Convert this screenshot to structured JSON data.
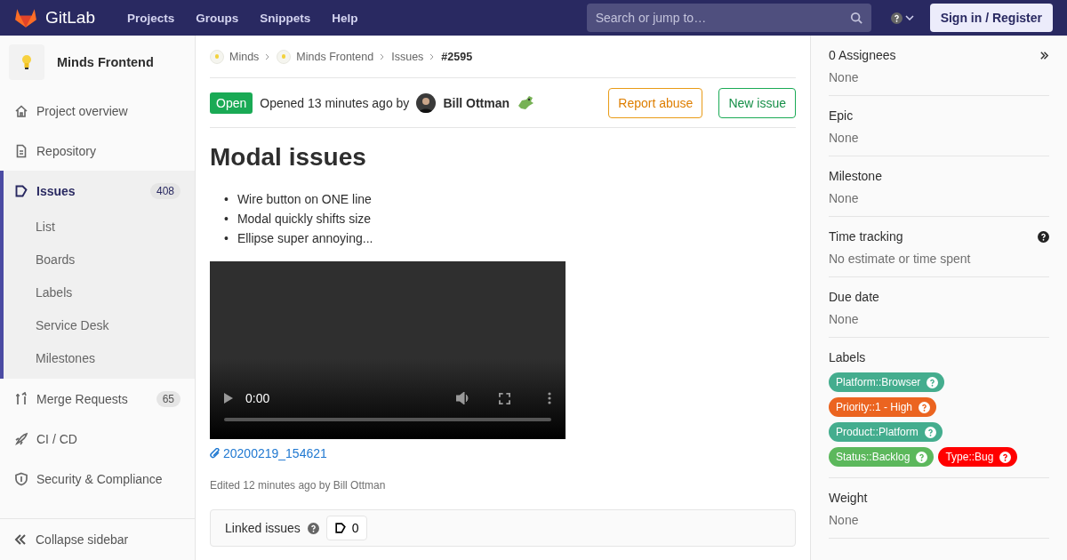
{
  "topbar": {
    "brand": "GitLab",
    "nav": [
      "Projects",
      "Groups",
      "Snippets",
      "Help"
    ],
    "search": {
      "placeholder": "Search or jump to…"
    },
    "sign_in": "Sign in / Register"
  },
  "sidebar": {
    "project": "Minds Frontend",
    "items": [
      {
        "label": "Project overview",
        "selected": false
      },
      {
        "label": "Repository",
        "selected": false
      },
      {
        "label": "Issues",
        "selected": true,
        "count": "408",
        "children": [
          {
            "label": "List"
          },
          {
            "label": "Boards"
          },
          {
            "label": "Labels"
          },
          {
            "label": "Service Desk"
          },
          {
            "label": "Milestones"
          }
        ]
      },
      {
        "label": "Merge Requests",
        "selected": false,
        "count": "65"
      },
      {
        "label": "CI / CD",
        "selected": false
      },
      {
        "label": "Security & Compliance",
        "selected": false
      }
    ],
    "collapse": "Collapse sidebar"
  },
  "breadcrumbs": [
    {
      "label": "Minds",
      "avatar": true
    },
    {
      "label": "Minds Frontend",
      "avatar": true
    },
    {
      "label": "Issues"
    },
    {
      "label": "#2595"
    }
  ],
  "issue": {
    "status": "Open",
    "opened": "Opened 13 minutes ago by",
    "author": "Bill Ottman",
    "actions": [
      {
        "label": "Report abuse",
        "kind": "warning"
      },
      {
        "label": "New issue",
        "kind": "success"
      }
    ],
    "title": "Modal issues",
    "bullets": [
      {
        "marker": "•",
        "text": "Wire button on ONE line"
      },
      {
        "marker": "•",
        "text": "Modal quickly shifts size"
      },
      {
        "marker": "•",
        "text": "Ellipse super annoying..."
      }
    ],
    "video": {
      "time": "0:00",
      "level": 0
    },
    "attachment": "20200219_154621",
    "edited": "Edited 12 minutes ago by Bill Ottman",
    "linked": {
      "label": "Linked issues",
      "count": "0"
    }
  },
  "right_sidebar": [
    {
      "title": "0 Assignees",
      "value": "None",
      "collapse": true
    },
    {
      "title": "Epic",
      "value": "None"
    },
    {
      "title": "Milestone",
      "value": "None"
    },
    {
      "title": "Time tracking",
      "value": "No estimate or time spent",
      "help": true
    },
    {
      "title": "Due date",
      "value": "None"
    },
    {
      "title": "Labels",
      "labels": [
        {
          "text": "Platform::Browser",
          "color": "#44ad8e"
        },
        {
          "text": "Priority::1 - High",
          "color": "#eb6420"
        },
        {
          "text": "Product::Platform",
          "color": "#44ad8e"
        },
        {
          "text": "Status::Backlog",
          "color": "#5cb85c"
        },
        {
          "text": "Type::Bug",
          "color": "#ff0000"
        }
      ]
    },
    {
      "title": "Weight",
      "value": "None"
    }
  ]
}
